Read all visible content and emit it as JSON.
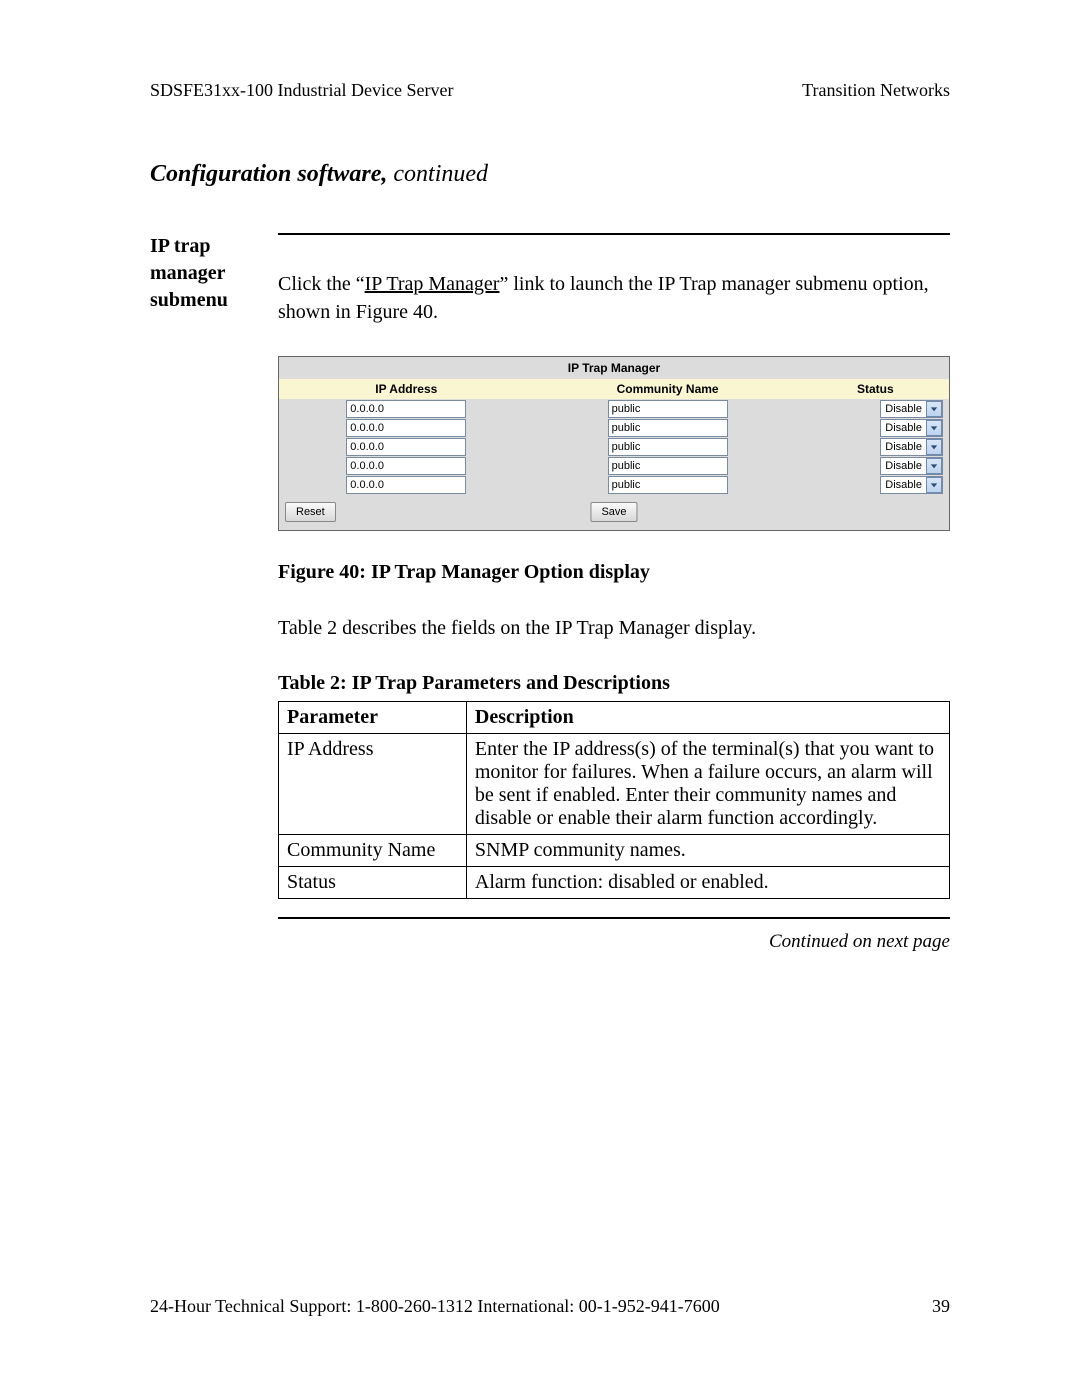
{
  "header": {
    "left": "SDSFE31xx-100 Industrial Device Server",
    "right": "Transition Networks"
  },
  "section": {
    "title_bold": "Configuration software,",
    "title_rest": " continued"
  },
  "side_label": "IP trap manager submenu",
  "body": {
    "pre": "Click the “",
    "link": "IP Trap Manager",
    "post": "” link to launch the IP Trap manager submenu option, shown in Figure 40."
  },
  "trap": {
    "title": "IP Trap Manager",
    "headers": {
      "ip": "IP Address",
      "cn": "Community Name",
      "st": "Status"
    },
    "rows": [
      {
        "ip": "0.0.0.0",
        "cn": "public",
        "st": "Disable"
      },
      {
        "ip": "0.0.0.0",
        "cn": "public",
        "st": "Disable"
      },
      {
        "ip": "0.0.0.0",
        "cn": "public",
        "st": "Disable"
      },
      {
        "ip": "0.0.0.0",
        "cn": "public",
        "st": "Disable"
      },
      {
        "ip": "0.0.0.0",
        "cn": "public",
        "st": "Disable"
      }
    ],
    "reset": "Reset",
    "save": "Save"
  },
  "figure_caption": "Figure 40:  IP Trap Manager Option display",
  "table_intro": "Table 2 describes the fields on the IP Trap Manager display.",
  "table_caption": "Table 2:  IP Trap Parameters and Descriptions",
  "param_table": {
    "headers": {
      "p": "Parameter",
      "d": "Description"
    },
    "rows": [
      {
        "p": "IP Address",
        "d": "Enter the IP address(s) of the terminal(s) that you want to monitor for failures. When a failure occurs, an alarm will be sent if enabled. Enter their community names and disable or enable their alarm function accordingly."
      },
      {
        "p": "Community Name",
        "d": "SNMP community names."
      },
      {
        "p": "Status",
        "d": "Alarm function:  disabled or enabled."
      }
    ]
  },
  "continued": "Continued on next page",
  "footer": {
    "left": "24-Hour Technical Support:   1-800-260-1312    International: 00-1-952-941-7600",
    "right": "39"
  }
}
